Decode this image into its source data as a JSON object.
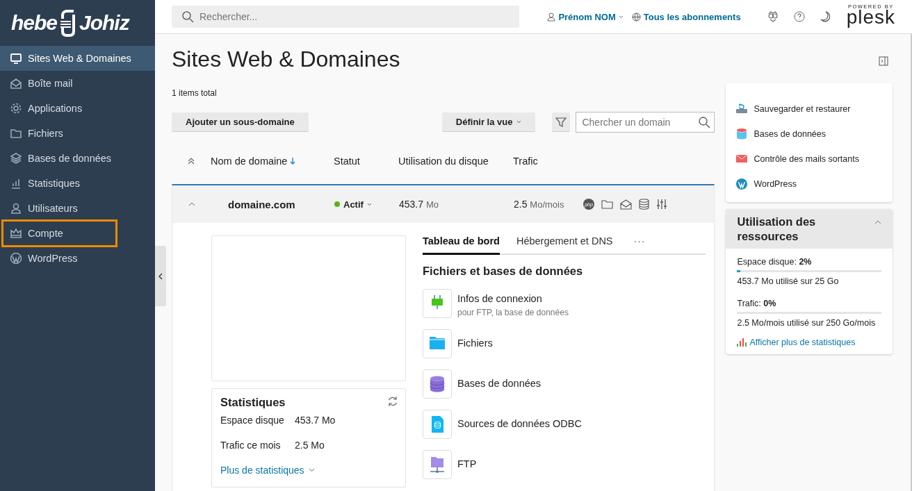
{
  "brand": {
    "logo_left": "hebe",
    "logo_right": "Johiz"
  },
  "sidebar": {
    "items": [
      {
        "label": "Sites Web & Domaines",
        "selected": true,
        "highlighted": false
      },
      {
        "label": "Boîte mail",
        "selected": false,
        "highlighted": false
      },
      {
        "label": "Applications",
        "selected": false,
        "highlighted": false
      },
      {
        "label": "Fichiers",
        "selected": false,
        "highlighted": false
      },
      {
        "label": "Bases de données",
        "selected": false,
        "highlighted": false
      },
      {
        "label": "Statistiques",
        "selected": false,
        "highlighted": false
      },
      {
        "label": "Utilisateurs",
        "selected": false,
        "highlighted": false
      },
      {
        "label": "Compte",
        "selected": false,
        "highlighted": true
      },
      {
        "label": "WordPress",
        "selected": false,
        "highlighted": false
      }
    ]
  },
  "topbar": {
    "search": {
      "placeholder": "Rechercher..."
    },
    "user": "Prénom NOM",
    "subscriptions": "Tous les abonnements",
    "powered_by": "POWERED BY",
    "plesk": "plesk"
  },
  "page": {
    "title": "Sites Web & Domaines",
    "total": "1 items total",
    "add_button": "Ajouter un sous-domaine",
    "view_button": "Définir la vue",
    "domain_search": {
      "placeholder": "Chercher un domain"
    }
  },
  "table": {
    "columns": [
      {
        "label": "Nom de domaine",
        "sorted": true
      },
      {
        "label": "Statut",
        "sorted": false
      },
      {
        "label": "Utilisation du disque",
        "sorted": false
      },
      {
        "label": "Trafic",
        "sorted": false
      }
    ],
    "rows": [
      {
        "domain": "domaine.com",
        "expanded": true,
        "status": {
          "label": "Actif",
          "active": true
        },
        "disk": "453.7",
        "disk_unit": "Mo",
        "traffic": "2.5",
        "traffic_unit": "Mo/mois",
        "php": "php"
      }
    ]
  },
  "detail": {
    "tabs": [
      {
        "label": "Tableau de bord",
        "selected": true
      },
      {
        "label": "Hébergement et DNS",
        "selected": false
      }
    ],
    "tabs_more": "···",
    "section_title": "Fichiers et bases de données",
    "tools": [
      {
        "title": "Infos de connexion",
        "subtitle": "pour FTP, la base de données"
      },
      {
        "title": "Fichiers"
      },
      {
        "title": "Bases de données"
      },
      {
        "title": "Sources de données ODBC"
      },
      {
        "title": "FTP"
      }
    ],
    "stats": {
      "title": "Statistiques",
      "rows": [
        {
          "label": "Espace disque",
          "value": "453.7 Mo"
        },
        {
          "label": "Trafic ce mois",
          "value": "2.5 Mo"
        }
      ],
      "link": "Plus de statistiques"
    }
  },
  "quick_links": [
    "Sauvegarder et restaurer",
    "Bases de données",
    "Contrôle des mails sortants",
    "WordPress"
  ],
  "resources": {
    "title": "Utilisation des ressources",
    "expanded": true,
    "meters": [
      {
        "label": "Espace disque: **2%**",
        "level": 0.02,
        "detail": "453.7 Mo utilisé sur 25 Go"
      },
      {
        "label": "Trafic: **0%**",
        "level": 0,
        "detail": "2.5 Mo/mois utilisé sur 250 Go/mois"
      }
    ],
    "link": "Afficher plus de statistiques"
  }
}
